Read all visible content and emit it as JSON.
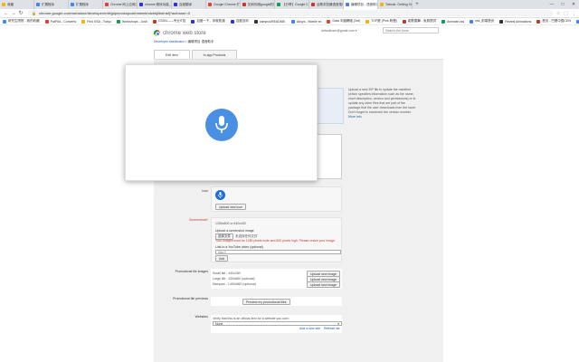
{
  "browser": {
    "tabs": [
      {
        "label": "收藏",
        "color": "#f4b400"
      },
      {
        "label": "扩展程序",
        "color": "#4285f4"
      },
      {
        "label": "扩展程序",
        "color": "#4285f4"
      },
      {
        "label": "Chrome 网上应用店 - 扩展程序",
        "color": "#db4437"
      },
      {
        "label": "chrome 程序功能_百度搜索",
        "color": "#2932e1"
      },
      {
        "label": "百度翻译",
        "color": "#2932e1"
      },
      {
        "label": "Google Chrome 扩展",
        "color": "#db4437"
      },
      {
        "label": "如何利用google的语音",
        "color": "#c53929"
      },
      {
        "label": "【分享】Google Chrome 扩",
        "color": "#0f9d58"
      },
      {
        "label": "谷歌浏览器语音搜索插件",
        "color": "#c53929"
      },
      {
        "label": "编辑项目 - 语音助手 - Edit Item",
        "color": "#4285f4",
        "active": true
      },
      {
        "label": "Tabook: Getting Started",
        "color": "#f4b400"
      }
    ],
    "new_tab_label": "+",
    "window_buttons": [
      "—",
      "□",
      "✕"
    ],
    "url": "chrome.google.com/webstore/developer/edit/jplpmonknpcakhmkmkhdcbhjilbdmkfj?authuser=0",
    "bookmarks": [
      {
        "label": "研究生院院 - 我的收藏",
        "color": "#4285f4"
      },
      {
        "label": "PaiPIIA - Converts",
        "color": "#db4437"
      },
      {
        "label": "Find SSA - Tokyo",
        "color": "#f4b400"
      },
      {
        "label": "Workshops - Justi",
        "color": "#0f9d58"
      },
      {
        "label": "CSDN——专业IT技",
        "color": "#c53929"
      },
      {
        "label": "百度一下，你就知道",
        "color": "#2932e1"
      },
      {
        "label": "百度百科",
        "color": "#2932e1"
      },
      {
        "label": "campus/README.",
        "color": "#333333"
      },
      {
        "label": "Aksys - Mobile ex",
        "color": "#4285f4"
      },
      {
        "label": "Data 中國網絡 (3rd)",
        "color": "#db4437"
      },
      {
        "label": "TOP推 (Pink 粉橙)",
        "color": "#f4b400"
      },
      {
        "label": "能歌善舞 - 免費提供",
        "color": "#c53929"
      },
      {
        "label": "Animate.css",
        "color": "#0f9d58"
      },
      {
        "label": "css_前端首页",
        "color": "#4285f4"
      },
      {
        "label": "Reveal Animations",
        "color": "#333333"
      },
      {
        "label": "首页 - 巴基中国CDN",
        "color": "#c53929"
      },
      {
        "label": "GUI Mobile Demo",
        "color": "#4285f4"
      }
    ]
  },
  "store": {
    "logo_text": "chrome web store",
    "user_email": "defaultuser@gmail.com ▾",
    "search_placeholder": "Search the store",
    "breadcrumb_parent": "Developer dashboard",
    "breadcrumb_sep": " > ",
    "breadcrumb_current": "编辑项目 语音助手",
    "tabs": [
      "Edit item",
      "In-app Products"
    ]
  },
  "sidenote": {
    "text": "Upload a new ZIP file to update the manifest (which specifies information such as the name, short description, version and permissions) or to update any other files that are part of the package that the user downloads from the store. Don't forget to increment the version number",
    "link": "More info"
  },
  "icon_row": {
    "label": "Icon",
    "button": "Upload new icon"
  },
  "screenshots_row": {
    "label": "Screenshots*",
    "dimensions": "1280x800 or 640x400",
    "upload_title": "Upload a screenshot image",
    "choose_file": "选择文件",
    "no_file": "未选择任何文件",
    "error": "Your images must be 1280 pixels wide and 800 pixels high. Please resize your image.",
    "video_label": "Link to a YouTube video (optional)",
    "video_placeholder": "http://",
    "add_button": "Add"
  },
  "promo_row": {
    "label": "Promotional tile images",
    "items": [
      {
        "name": "Small tile - 440x280",
        "button": "Upload new image"
      },
      {
        "name": "Large tile - 920x680",
        "note": "(optional)",
        "button": "Upload new image"
      },
      {
        "name": "Marquee - 1400x560",
        "note": "(optional)",
        "button": "Upload new image"
      }
    ]
  },
  "preview_row": {
    "label": "Promotional tile previews",
    "button": "Preview my promotional tiles"
  },
  "websites_row": {
    "label": "Websites",
    "verify_text": "Verify that this is an official item for a website you own:",
    "select_value": "None",
    "add_site": "Add a new site",
    "refresh": "Refresh list"
  },
  "voice": {
    "mic_icon": "microphone-icon",
    "accent": "#4a90e2"
  }
}
